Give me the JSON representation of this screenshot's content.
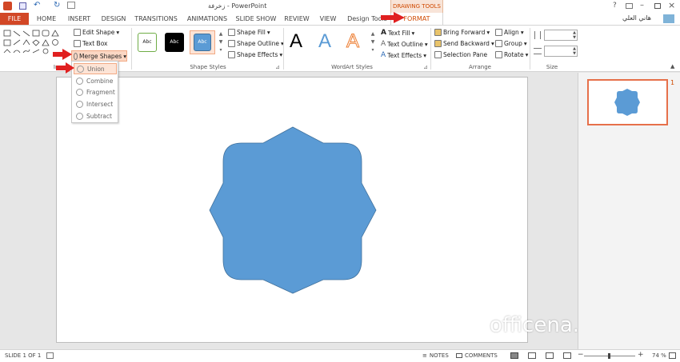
{
  "titlebar": {
    "title": "زخرفة - PowerPoint",
    "contextual_group": "DRAWING TOOLS",
    "help": "?",
    "user_name": "هاني العلي"
  },
  "tabs": [
    {
      "label": "FILE"
    },
    {
      "label": "HOME"
    },
    {
      "label": "INSERT"
    },
    {
      "label": "DESIGN"
    },
    {
      "label": "TRANSITIONS"
    },
    {
      "label": "ANIMATIONS"
    },
    {
      "label": "SLIDE SHOW"
    },
    {
      "label": "REVIEW"
    },
    {
      "label": "VIEW"
    },
    {
      "label": "Design Tools"
    },
    {
      "label": "FORMAT"
    }
  ],
  "ribbon": {
    "insert_shapes": {
      "edit_shape": "Edit Shape",
      "text_box": "Text Box",
      "merge_shapes": "Merge Shapes",
      "label": "Ins"
    },
    "shape_styles": {
      "style_samples": [
        "Abc",
        "Abc",
        "Abc"
      ],
      "fill": "Shape Fill",
      "outline": "Shape Outline",
      "effects": "Shape Effects",
      "label": "Shape Styles"
    },
    "wordart": {
      "samples": [
        "A",
        "A",
        "A"
      ],
      "text_fill": "Text Fill",
      "text_outline": "Text Outline",
      "text_effects": "Text Effects",
      "label": "WordArt Styles"
    },
    "arrange": {
      "bring_forward": "Bring Forward",
      "send_backward": "Send Backward",
      "selection_pane": "Selection Pane",
      "align": "Align",
      "group": "Group",
      "rotate": "Rotate",
      "label": "Arrange"
    },
    "size": {
      "label": "Size"
    }
  },
  "merge_menu": {
    "items": [
      "Union",
      "Combine",
      "Fragment",
      "Intersect",
      "Subtract"
    ]
  },
  "thumbnails": {
    "slide_number": "1"
  },
  "watermark": "officena.net",
  "status": {
    "slide": "SLIDE 1 OF 1",
    "notes": "NOTES",
    "comments": "COMMENTS",
    "zoom": "74 %"
  },
  "colors": {
    "accent": "#d04a02",
    "shape": "#5b9bd5",
    "arrow": "#e02020"
  }
}
